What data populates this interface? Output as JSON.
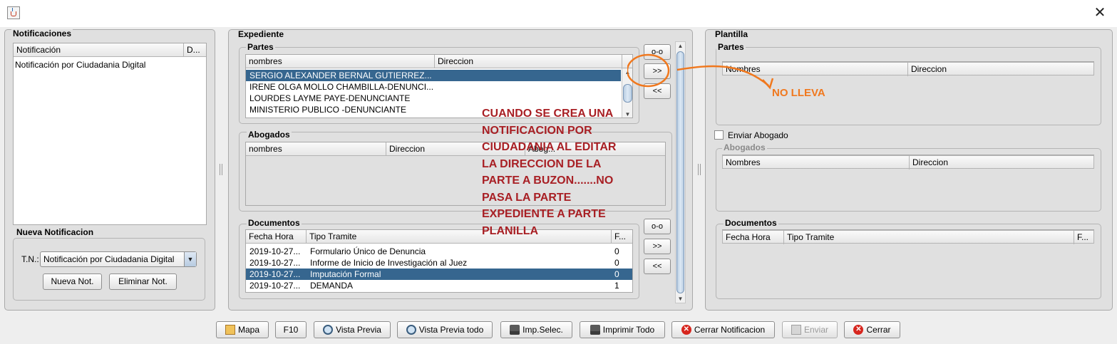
{
  "window": {
    "close_glyph": "✕",
    "app_icon": "java-cup-icon"
  },
  "notificaciones": {
    "title": "Notificaciones",
    "columns": [
      "Notificación",
      "D..."
    ],
    "rows": [
      [
        "Notificación por Ciudadania Digital",
        ""
      ]
    ],
    "nueva": {
      "title": "Nueva Notificacion",
      "tn_label": "T.N.:",
      "tn_value": "Notificación por Ciudadania Digital",
      "nueva_button": "Nueva Not.",
      "eliminar_button": "Eliminar Not."
    }
  },
  "expediente": {
    "title": "Expediente",
    "partes": {
      "title": "Partes",
      "columns": [
        "nombres",
        "Direccion"
      ],
      "rows": [
        [
          "SERGIO ALEXANDER BERNAL GUTIERREZ...",
          ""
        ],
        [
          "IRENE OLGA MOLLO CHAMBILLA-DENUNCI...",
          ""
        ],
        [
          "LOURDES LAYME PAYE-DENUNCIANTE",
          ""
        ],
        [
          "MINISTERIO PUBLICO  -DENUNCIANTE",
          ""
        ]
      ],
      "selected_row": 0
    },
    "abogados": {
      "title": "Abogados",
      "columns": [
        "nombres",
        "Direccion",
        "Abog..."
      ]
    },
    "documentos": {
      "title": "Documentos",
      "columns": [
        "Fecha Hora",
        "Tipo Tramite",
        "F..."
      ],
      "rows": [
        [
          "2019-10-27...",
          "Formulario Único de Denuncia",
          "0"
        ],
        [
          "2019-10-27...",
          "Informe de Inicio de Investigación al Juez",
          "0"
        ],
        [
          "2019-10-27...",
          "Imputación Formal",
          "0"
        ],
        [
          "2019-10-27...",
          "DEMANDA",
          "1"
        ]
      ],
      "selected_row": 2
    }
  },
  "transfer_buttons": {
    "partes": [
      "o-o",
      ">>",
      "<<"
    ],
    "documentos": [
      "o-o",
      ">>",
      "<<"
    ]
  },
  "plantilla": {
    "title": "Plantilla",
    "partes": {
      "title": "Partes",
      "columns": [
        "Nombres",
        "Direccion"
      ]
    },
    "enviar_abogado": {
      "label": "Enviar Abogado",
      "checked": false
    },
    "abogados": {
      "title": "Abogados",
      "columns": [
        "Nombres",
        "Direccion"
      ]
    },
    "documentos": {
      "title": "Documentos",
      "columns": [
        "Fecha Hora",
        "Tipo Tramite",
        "F..."
      ]
    }
  },
  "annotations": {
    "note_lines": [
      "CUANDO SE CREA UNA",
      "NOTIFICACION POR",
      "CIUDADANIA AL EDITAR",
      "LA DIRECCION DE LA",
      "PARTE A BUZON.......NO",
      "PASA LA PARTE",
      "EXPEDIENTE A PARTE",
      "PLANILLA"
    ],
    "no_lleva": "NO LLEVA",
    "note_color": "#a81f24",
    "highlight_color": "#f0781e"
  },
  "toolbar": {
    "buttons": [
      {
        "label": "Mapa",
        "icon": "map-icon",
        "enabled": true
      },
      {
        "label": "F10",
        "icon": "",
        "enabled": true
      },
      {
        "label": "Vista Previa",
        "icon": "magnifier-icon",
        "enabled": true
      },
      {
        "label": "Vista Previa todo",
        "icon": "magnifier-icon",
        "enabled": true
      },
      {
        "label": "Imp.Selec.",
        "icon": "printer-icon",
        "enabled": true
      },
      {
        "label": "Imprimir Todo",
        "icon": "printer-icon",
        "enabled": true
      },
      {
        "label": "Cerrar Notificacion",
        "icon": "close-circle-icon",
        "enabled": true
      },
      {
        "label": "Enviar",
        "icon": "document-icon",
        "enabled": false
      },
      {
        "label": "Cerrar",
        "icon": "close-circle-icon",
        "enabled": true
      }
    ]
  },
  "colors": {
    "selection": "#36668f",
    "panel": "#e0e0e0"
  }
}
